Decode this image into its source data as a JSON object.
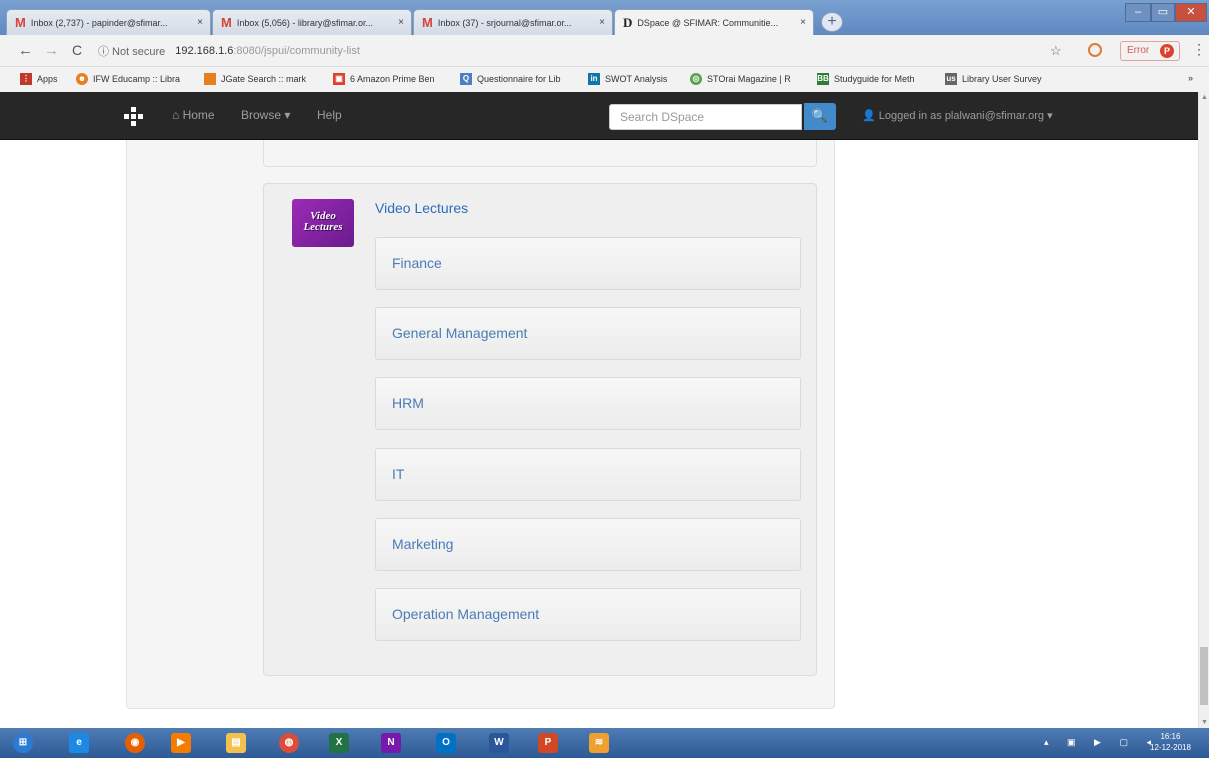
{
  "browser": {
    "tabs": [
      {
        "icon": "M",
        "label": "Inbox (2,737) - papinder@sfimar..."
      },
      {
        "icon": "M",
        "label": "Inbox (5,056) - library@sfimar.or..."
      },
      {
        "icon": "M",
        "label": "Inbox (37) - srjournal@sfimar.or..."
      },
      {
        "icon": "D",
        "label": "DSpace @ SFIMAR: Communitie..."
      }
    ],
    "tab_close": "×",
    "new_tab": "+",
    "window_controls": [
      "–",
      "▭",
      "✕"
    ],
    "nav": {
      "back": "←",
      "forward": "→",
      "reload": "C"
    },
    "address": {
      "security": "ⓘ Not secure",
      "host": "192.168.1.6",
      "path": ":8080/jspui/community-list"
    },
    "star": "☆",
    "error_label": "Error",
    "profile_initial": "P",
    "menu": "⋮",
    "bookmarks": [
      {
        "label": "Apps",
        "color": "#c0392b",
        "glyph": "⋮"
      },
      {
        "label": "IFW Educamp :: Libra",
        "color": "#e67e22",
        "glyph": "☻"
      },
      {
        "label": "JGate Search :: mark",
        "color": "#e67e22",
        "glyph": ""
      },
      {
        "label": "6 Amazon Prime Ben",
        "color": "#d9432f",
        "glyph": "▣"
      },
      {
        "label": "Questionnaire for Lib",
        "color": "#4a7fc1",
        "glyph": "Q"
      },
      {
        "label": "SWOT Analysis",
        "color": "#0e76a8",
        "glyph": "in"
      },
      {
        "label": "STOrai Magazine | R",
        "color": "#59a14f",
        "glyph": "◎"
      },
      {
        "label": "Studyguide for Meth",
        "color": "#2e7d32",
        "glyph": "BB"
      },
      {
        "label": "Library User Survey",
        "color": "#666",
        "glyph": "us"
      }
    ],
    "bookmarks_more": "»"
  },
  "dspace": {
    "nav": {
      "home": "Home",
      "browse": "Browse ▾",
      "help": "Help"
    },
    "search_placeholder": "Search DSpace",
    "search_button": "🔍",
    "user": "Logged in as plalwani@sfimar.org ▾",
    "community": {
      "logo_text": "Video Lectures",
      "title": "Video Lectures",
      "subcommunities": [
        "Finance",
        "General Management",
        "HRM",
        "IT",
        "Marketing",
        "Operation Management"
      ]
    }
  },
  "taskbar": {
    "apps": [
      {
        "name": "start",
        "glyph": "⊞",
        "color": "#2b7bd4"
      },
      {
        "name": "ie",
        "glyph": "e",
        "color": "#1e88e5"
      },
      {
        "name": "firefox",
        "glyph": "◉",
        "color": "#e66000"
      },
      {
        "name": "media",
        "glyph": "▶",
        "color": "#f57c00"
      },
      {
        "name": "explorer",
        "glyph": "▤",
        "color": "#f2c14e"
      },
      {
        "name": "chrome",
        "glyph": "◍",
        "color": "#dd4b39"
      },
      {
        "name": "excel",
        "glyph": "X",
        "color": "#217346"
      },
      {
        "name": "onenote",
        "glyph": "N",
        "color": "#7719aa"
      },
      {
        "name": "outlook",
        "glyph": "O",
        "color": "#0072c6"
      },
      {
        "name": "word",
        "glyph": "W",
        "color": "#2b579a"
      },
      {
        "name": "powerpoint",
        "glyph": "P",
        "color": "#d24726"
      },
      {
        "name": "app",
        "glyph": "≋",
        "color": "#f0a030"
      }
    ],
    "tray": "▴ ▣ ▶ ▢ ◂",
    "time": "16:16",
    "date": "12-12-2018"
  }
}
